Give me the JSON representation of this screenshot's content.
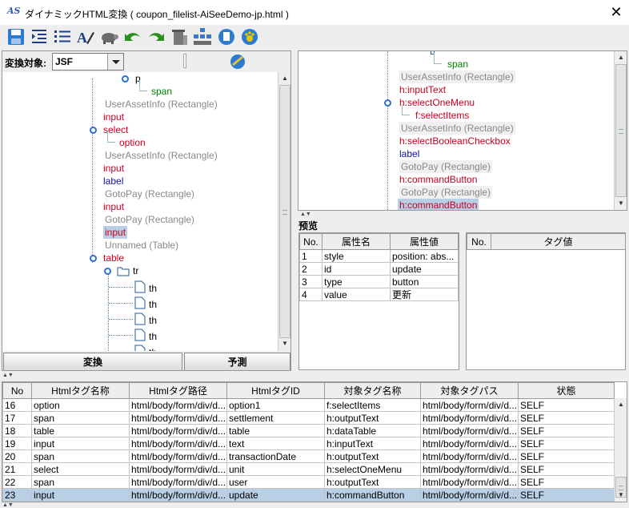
{
  "window": {
    "title": "ダイナミックHTML変換 ( coupon_filelist-AiSeeDemo-jp.html )",
    "icon_text": "AS",
    "close_glyph": "✕"
  },
  "toolbar": {
    "icons": [
      "save-icon",
      "indent-icon",
      "list-icon",
      "format-icon",
      "turtle-icon",
      "undo-icon",
      "redo-icon",
      "trash-icon",
      "tree-icon",
      "info-icon",
      "paw-icon"
    ]
  },
  "left_panel": {
    "target_label": "変換対象:",
    "target_value": "JSF",
    "tree": [
      {
        "text": "p",
        "color": "blk"
      },
      {
        "text": "span",
        "color": "grn"
      },
      {
        "text": "UserAssetInfo (Rectangle)",
        "color": "gry"
      },
      {
        "text": "input",
        "color": "red"
      },
      {
        "text": "select",
        "color": "red"
      },
      {
        "text": "option",
        "color": "red"
      },
      {
        "text": "UserAssetInfo (Rectangle)",
        "color": "gry"
      },
      {
        "text": "input",
        "color": "red"
      },
      {
        "text": "label",
        "color": "blu"
      },
      {
        "text": "GotoPay (Rectangle)",
        "color": "gry"
      },
      {
        "text": "input",
        "color": "red"
      },
      {
        "text": "GotoPay (Rectangle)",
        "color": "gry"
      },
      {
        "text": "input",
        "color": "red"
      },
      {
        "text": "Unnamed (Table)",
        "color": "gry"
      },
      {
        "text": "table",
        "color": "red"
      },
      {
        "text": "tr",
        "color": "blk"
      },
      {
        "text": "th",
        "color": "blk"
      },
      {
        "text": "th",
        "color": "blk"
      },
      {
        "text": "th",
        "color": "blk"
      },
      {
        "text": "th",
        "color": "blk"
      },
      {
        "text": "th",
        "color": "blk"
      }
    ],
    "convert_button": "変換",
    "predict_button": "予測"
  },
  "right_tree": [
    {
      "text": "span",
      "color": "grn"
    },
    {
      "text": "UserAssetInfo (Rectangle)",
      "color": "gry"
    },
    {
      "text": "h:inputText",
      "color": "red"
    },
    {
      "text": "h:selectOneMenu",
      "color": "red"
    },
    {
      "text": "f:selectItems",
      "color": "red"
    },
    {
      "text": "UserAssetInfo (Rectangle)",
      "color": "gry"
    },
    {
      "text": "h:selectBooleanCheckbox",
      "color": "red"
    },
    {
      "text": "label",
      "color": "blu"
    },
    {
      "text": "GotoPay (Rectangle)",
      "color": "gry"
    },
    {
      "text": "h:commandButton",
      "color": "red"
    },
    {
      "text": "GotoPay (Rectangle)",
      "color": "gry"
    },
    {
      "text": "h:commandButton",
      "color": "red"
    }
  ],
  "preview": {
    "label": "预览",
    "attr_headers": [
      "No.",
      "属性名",
      "属性値"
    ],
    "attr_rows": [
      [
        "1",
        "style",
        "position: abs..."
      ],
      [
        "2",
        "id",
        "update"
      ],
      [
        "3",
        "type",
        "button"
      ],
      [
        "4",
        "value",
        "更新"
      ]
    ],
    "tag_headers": [
      "No.",
      "タグ値"
    ]
  },
  "bottom_table": {
    "headers": [
      "No",
      "Htmlタグ名称",
      "Htmlタグ路径",
      "HtmlタグID",
      "対象タグ名称",
      "対象タグパス",
      "状態"
    ],
    "rows": [
      [
        "16",
        "option",
        "html/body/form/div/d...",
        "option1",
        "f:selectItems",
        "html/body/form/div/d...",
        "SELF"
      ],
      [
        "17",
        "span",
        "html/body/form/div/d...",
        "settlement",
        "h:outputText",
        "html/body/form/div/d...",
        "SELF"
      ],
      [
        "18",
        "table",
        "html/body/form/div/d...",
        "table",
        "h:dataTable",
        "html/body/form/div/d...",
        "SELF"
      ],
      [
        "19",
        "input",
        "html/body/form/div/d...",
        "text",
        "h:inputText",
        "html/body/form/div/d...",
        "SELF"
      ],
      [
        "20",
        "span",
        "html/body/form/div/d...",
        "transactionDate",
        "h:outputText",
        "html/body/form/div/d...",
        "SELF"
      ],
      [
        "21",
        "select",
        "html/body/form/div/d...",
        "unit",
        "h:selectOneMenu",
        "html/body/form/div/d...",
        "SELF"
      ],
      [
        "22",
        "span",
        "html/body/form/div/d...",
        "user",
        "h:outputText",
        "html/body/form/div/d...",
        "SELF"
      ],
      [
        "23",
        "input",
        "html/body/form/div/d...",
        "update",
        "h:commandButton",
        "html/body/form/div/d...",
        "SELF"
      ]
    ]
  }
}
